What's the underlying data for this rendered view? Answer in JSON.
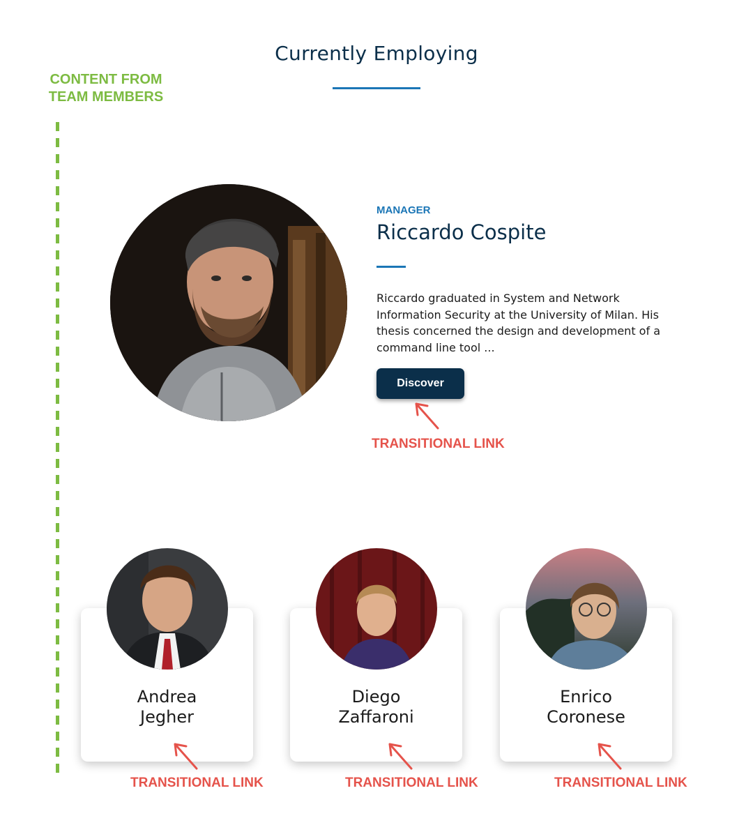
{
  "section": {
    "title": "Currently Employing"
  },
  "annotations": {
    "content_label_line1": "CONTENT FROM",
    "content_label_line2": "TEAM MEMBERS",
    "link_label": "TRANSITIONAL LINK"
  },
  "manager": {
    "role": "MANAGER",
    "name": "Riccardo Cospite",
    "bio": "Riccardo graduated in System and Network Information Security at the University of Milan. His thesis concerned the design and development of a command line tool ...",
    "button_label": "Discover"
  },
  "team": [
    {
      "first_name": "Andrea",
      "last_name": "Jegher"
    },
    {
      "first_name": "Diego",
      "last_name": "Zaffaroni"
    },
    {
      "first_name": "Enrico",
      "last_name": "Coronese"
    }
  ],
  "colors": {
    "navy": "#0b2f4a",
    "accent_blue": "#1b76b6",
    "annotation_green": "#7dbb42",
    "annotation_red": "#e5534b"
  }
}
